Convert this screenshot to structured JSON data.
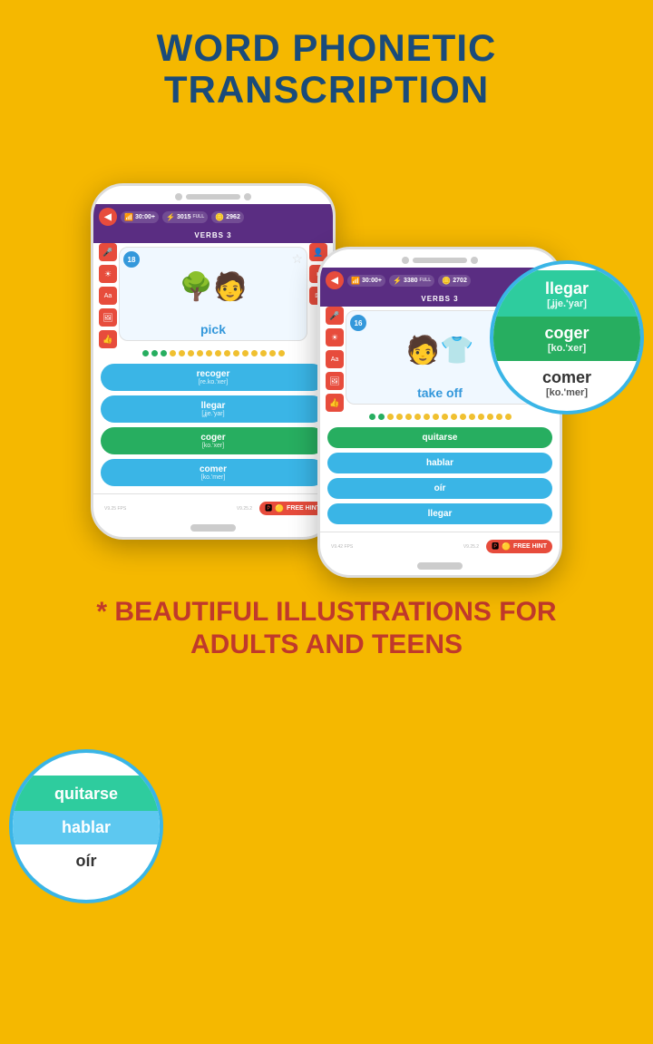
{
  "title": {
    "line1": "WORD PHONETIC",
    "line2": "TRANSCRIPTION"
  },
  "phone_left": {
    "stats": {
      "time": "30:00+",
      "xp": "3015",
      "xp_label": "FULL",
      "coins": "2962"
    },
    "section": "VERBS 3",
    "card": {
      "number": "18",
      "word": "pick",
      "emoji": "🌳"
    },
    "answers": [
      {
        "word": "recoger",
        "phonetic": "[re.ko.'xer]",
        "style": "blue"
      },
      {
        "word": "llegar",
        "phonetic": "[ʝje.'yar]",
        "style": "blue"
      },
      {
        "word": "coger",
        "phonetic": "[ko.'xer]",
        "style": "green"
      },
      {
        "word": "comer",
        "phonetic": "[ko.'mer]",
        "style": "blue"
      }
    ],
    "hint": "FREE HINT",
    "fps_left": "V9.25 FPS",
    "fps_right": "V9.25.2"
  },
  "phone_right": {
    "stats": {
      "time": "30:00+",
      "xp": "3380",
      "xp_label": "FULL",
      "coins": "2702"
    },
    "section": "VERBS 3",
    "card": {
      "number": "16",
      "word": "take off",
      "emoji": "👕"
    },
    "answers": [
      {
        "word": "quitarse",
        "style": "green"
      },
      {
        "word": "hablar",
        "style": "blue"
      },
      {
        "word": "oír",
        "style": "blue"
      },
      {
        "word": "llegar",
        "style": "blue"
      }
    ],
    "hint": "FREE HINT",
    "fps_left": "V9.42 FPS",
    "fps_right": "V9.25.2"
  },
  "circle_right": {
    "items": [
      {
        "word": "llegar",
        "phonetic": "[ʝje.'yar]",
        "style": "teal"
      },
      {
        "word": "coger",
        "phonetic": "[ko.'xer]",
        "style": "green"
      },
      {
        "word": "comer",
        "phonetic": "[ko.'mer]",
        "style": "white"
      }
    ]
  },
  "circle_left": {
    "items": [
      {
        "word": "quitarse",
        "style": "teal"
      },
      {
        "word": "hablar",
        "style": "ltblue"
      },
      {
        "word": "oír",
        "style": "white"
      }
    ]
  },
  "bottom": {
    "line1": "* BEAUTIFUL ILLUSTRATIONS FOR",
    "line2": "ADULTS AND TEENS"
  },
  "icons": {
    "mic": "🎤",
    "sun": "☀",
    "text": "Aa",
    "photo": "🖼",
    "thumb": "👍",
    "person": "👤",
    "pause": "⏸",
    "mail": "✉",
    "back": "◀",
    "star": "☆",
    "coin": "🪙",
    "lightning": "⚡",
    "wifi": "📶"
  },
  "dots": {
    "active_count": 3,
    "inactive_count": 13
  }
}
